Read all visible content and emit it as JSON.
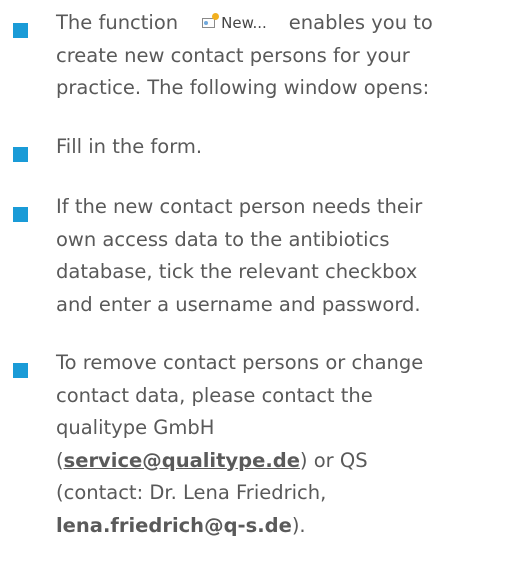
{
  "colors": {
    "bullet": "#1a9bd7",
    "text": "#595959"
  },
  "items": [
    {
      "line1_pre": "The function",
      "button_label": "New...",
      "button_icon": "new-contact-icon",
      "line1_post": "enables you to",
      "line2": "create new contact persons for your",
      "line3": "practice. The following window opens:"
    },
    {
      "line1": "Fill in the form."
    },
    {
      "line1": "If the new contact person needs their",
      "line2": "own access data to the antibiotics",
      "line3": "database, tick the relevant checkbox",
      "line4": "and enter a username and password."
    },
    {
      "line1": "To remove contact persons or change",
      "line2": "contact data, please contact the",
      "line3": "qualitype GmbH",
      "line4_open": "(",
      "line4_link": "service@qualitype.de",
      "line4_close": ") or QS",
      "line5": "(contact: Dr. Lena Friedrich,",
      "line6_link": "lena.friedrich@q-s.de",
      "line6_close": ")."
    }
  ]
}
